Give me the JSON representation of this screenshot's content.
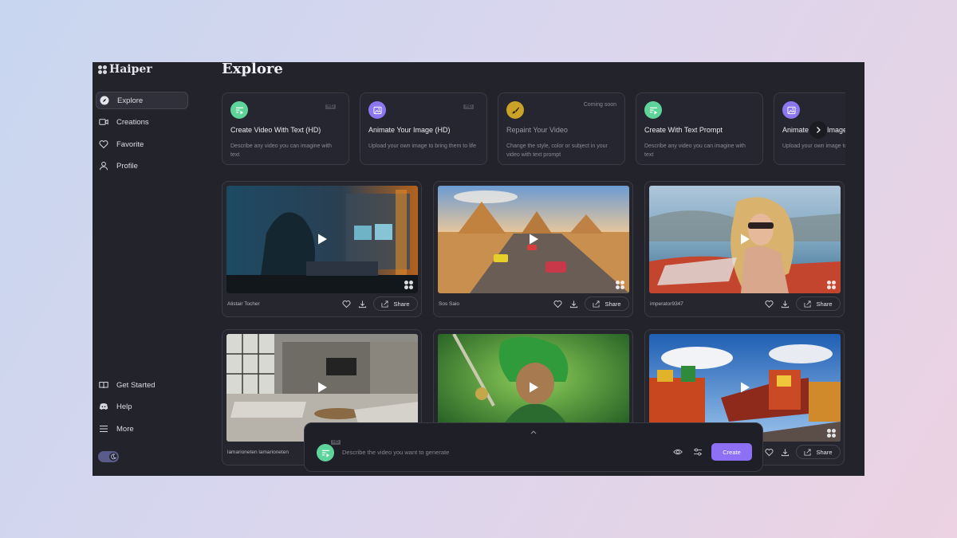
{
  "app": {
    "name": "Haiper",
    "page_title": "Explore"
  },
  "sidebar": {
    "items": [
      {
        "label": "Explore",
        "icon": "compass-icon",
        "active": true
      },
      {
        "label": "Creations",
        "icon": "video-camera-icon"
      },
      {
        "label": "Favorite",
        "icon": "heart-icon"
      },
      {
        "label": "Profile",
        "icon": "user-icon"
      }
    ],
    "bottom_items": [
      {
        "label": "Get Started",
        "icon": "book-open-icon"
      },
      {
        "label": "Help",
        "icon": "discord-icon"
      },
      {
        "label": "More",
        "icon": "menu-icon"
      }
    ],
    "theme_toggle": "moon-icon"
  },
  "tools": [
    {
      "title": "Create Video With Text (HD)",
      "desc": "Describe any video you can imagine with text",
      "badge": "HD",
      "icon_color": "#5fd49a"
    },
    {
      "title": "Animate Your Image (HD)",
      "desc": "Upload your own image to bring them to life",
      "badge": "HD",
      "icon_color": "#8c77f0"
    },
    {
      "title": "Repaint Your Video",
      "desc": "Change the style, color or subject in your video with text prompt",
      "status": "Coming soon",
      "icon_color": "#c9a227"
    },
    {
      "title": "Create With Text Prompt",
      "desc": "Describe any video you can imagine with text",
      "icon_color": "#5fd49a"
    },
    {
      "title": "Animate Your Image",
      "desc": "Upload your own image to bring them to life",
      "icon_color": "#8c77f0"
    }
  ],
  "videos": [
    {
      "author": "Alistair Tocher",
      "scene": "hooded-hacker-studio"
    },
    {
      "author": "Sos Saio",
      "scene": "pyramids-racing-cars"
    },
    {
      "author": "imperator9347",
      "scene": "woman-convertible-sunglasses"
    },
    {
      "author": "lamarioneten lamarioneten",
      "scene": "loft-living-room"
    },
    {
      "author": "",
      "scene": "green-haired-swordsman"
    },
    {
      "author": "",
      "scene": "train-lego-city"
    }
  ],
  "share_label": "Share",
  "prompt_bar": {
    "placeholder": "Describe the video you want to generate",
    "badge": "HD",
    "create_label": "Create"
  },
  "colors": {
    "accent": "#8d70f5",
    "background": "#23232b"
  }
}
